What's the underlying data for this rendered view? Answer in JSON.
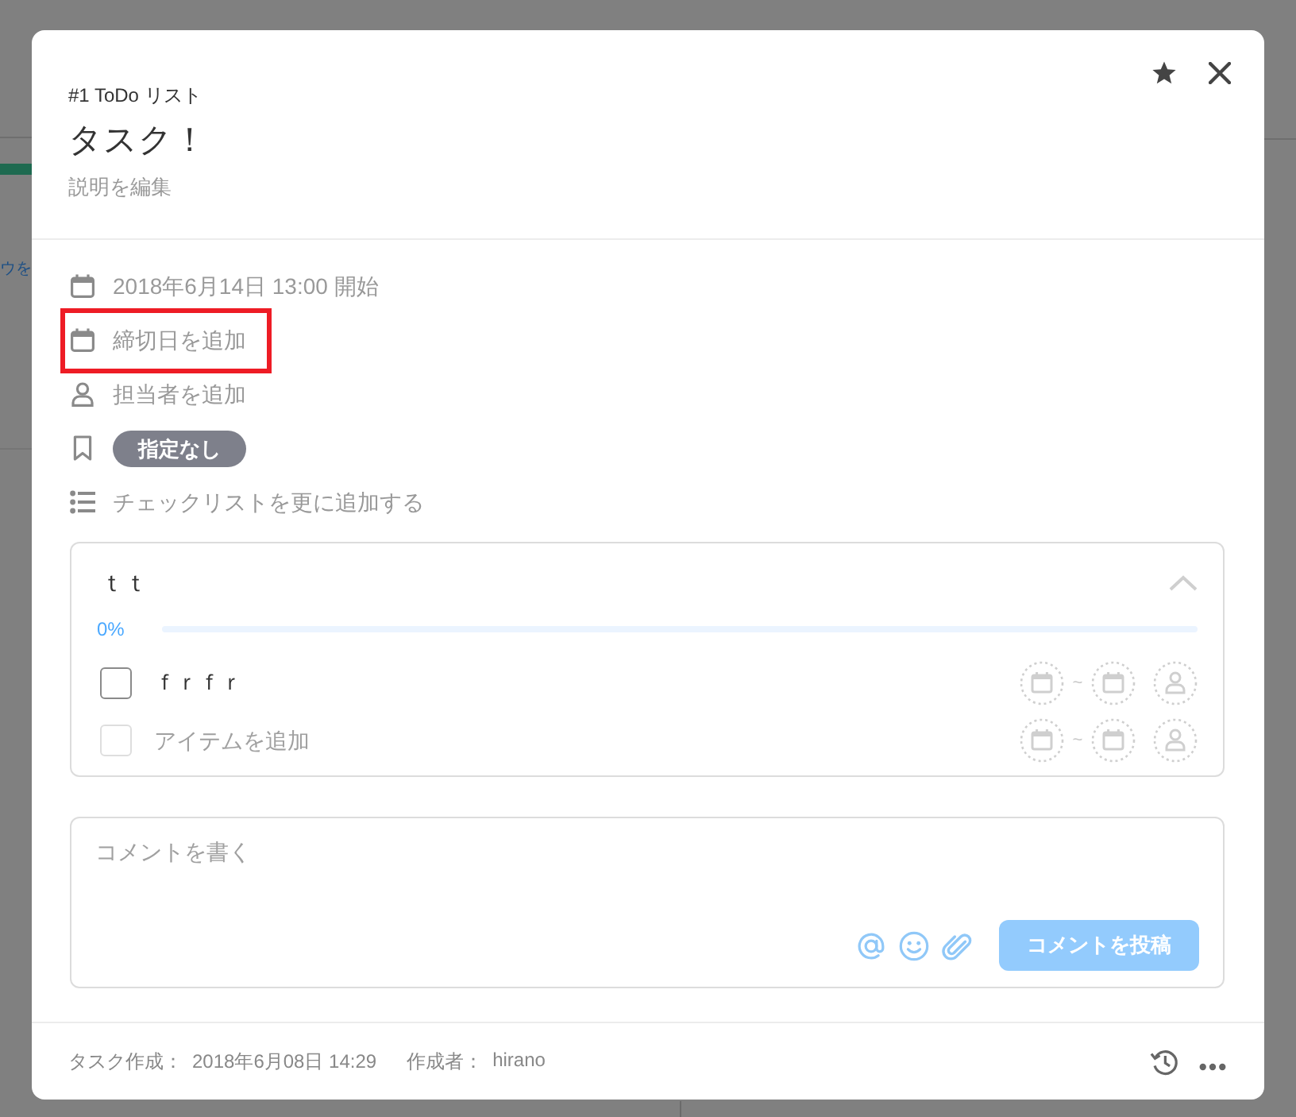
{
  "background": {
    "link_fragment": "ウを"
  },
  "dialog": {
    "list_name": "#1 ToDo リスト",
    "title": "タスク！",
    "description_link": "説明を編集"
  },
  "properties": [
    {
      "kind": "start_date",
      "text": "2018年6月14日 13:00 開始",
      "highlighted": false
    },
    {
      "kind": "due_date",
      "text": "締切日を追加",
      "highlighted": true
    },
    {
      "kind": "assignee",
      "text": "担当者を追加",
      "highlighted": false
    },
    {
      "kind": "tag",
      "text": "指定なし",
      "highlighted": false
    },
    {
      "kind": "checklist",
      "text": "チェックリストを更に追加する",
      "highlighted": false
    }
  ],
  "checklist": {
    "title": "ｔｔ",
    "expanded": true,
    "progress": {
      "reading": "0%",
      "level": 0
    },
    "items": [
      {
        "text": "ｆｒｆｒ",
        "checked": false,
        "date_separator": "~"
      }
    ],
    "add_item": {
      "placeholder": "アイテムを追加",
      "checked": false,
      "disabled": true,
      "date_separator": "~"
    }
  },
  "comment": {
    "placeholder": "コメントを書く",
    "submit": {
      "label": "コメントを投稿",
      "disabled": true
    }
  },
  "footer": {
    "meta": [
      {
        "label": "タスク作成：",
        "value": "2018年6月08日 14:29"
      },
      {
        "label": "作成者：",
        "value": "hirano"
      }
    ]
  }
}
